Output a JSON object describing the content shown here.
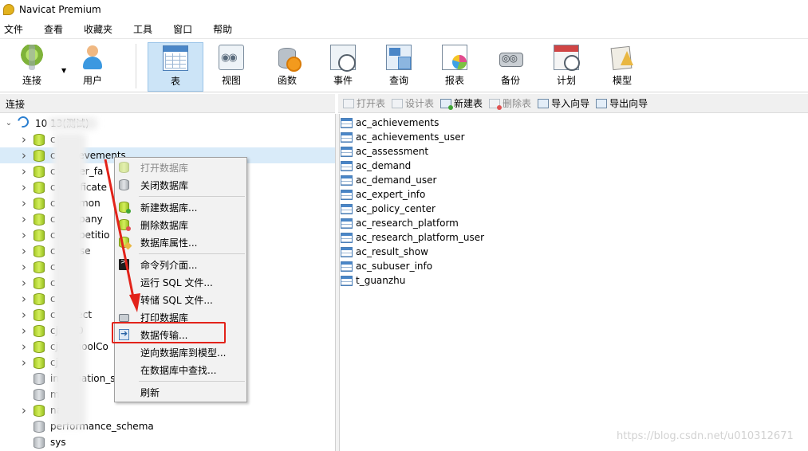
{
  "window": {
    "title": "Navicat Premium"
  },
  "menubar": [
    "文件",
    "查看",
    "收藏夹",
    "工具",
    "窗口",
    "帮助"
  ],
  "toolbar": {
    "buttons": [
      {
        "label": "连接",
        "icon": "connection-icon"
      },
      {
        "label": "用户",
        "icon": "user-icon"
      },
      {
        "label": "表",
        "icon": "table-icon",
        "active": true
      },
      {
        "label": "视图",
        "icon": "view-icon"
      },
      {
        "label": "函数",
        "icon": "function-icon"
      },
      {
        "label": "事件",
        "icon": "event-icon"
      },
      {
        "label": "查询",
        "icon": "query-icon"
      },
      {
        "label": "报表",
        "icon": "report-icon"
      },
      {
        "label": "备份",
        "icon": "backup-icon"
      },
      {
        "label": "计划",
        "icon": "schedule-icon"
      },
      {
        "label": "模型",
        "icon": "model-icon"
      }
    ]
  },
  "connections_panel": {
    "header": "连接",
    "connection_label": "10           13(测试)",
    "tree_items": [
      {
        "label": "c",
        "icon": "database-open-icon",
        "expandable": true
      },
      {
        "label": "c   achievements",
        "icon": "database-open-icon",
        "expandable": true,
        "selected": true
      },
      {
        "label": "c   career_fa",
        "icon": "database-open-icon",
        "expandable": true
      },
      {
        "label": "c   certificate",
        "icon": "database-open-icon",
        "expandable": true
      },
      {
        "label": "c   common",
        "icon": "database-open-icon",
        "expandable": true
      },
      {
        "label": "c   company",
        "icon": "database-open-icon",
        "expandable": true
      },
      {
        "label": "c   competitio",
        "icon": "database-open-icon",
        "expandable": true
      },
      {
        "label": "c   course",
        "icon": "database-open-icon",
        "expandable": true
      },
      {
        "label": "c       xy",
        "icon": "database-open-icon",
        "expandable": true
      },
      {
        "label": "c",
        "icon": "database-open-icon",
        "expandable": true
      },
      {
        "label": "c       p",
        "icon": "database-open-icon",
        "expandable": true
      },
      {
        "label": "c   project",
        "icon": "database-open-icon",
        "expandable": true
      },
      {
        "label": "cjr      100",
        "icon": "database-open-icon",
        "expandable": true
      },
      {
        "label": "cjr  schoolCo",
        "icon": "database-open-icon",
        "expandable": true
      },
      {
        "label": "cj    use",
        "icon": "database-open-icon",
        "expandable": true
      },
      {
        "label": "information_s",
        "icon": "database-closed-icon",
        "expandable": false
      },
      {
        "label": "mysql",
        "icon": "database-closed-icon",
        "expandable": false
      },
      {
        "label": "nacos",
        "icon": "database-open-icon",
        "expandable": true
      },
      {
        "label": "performance_schema",
        "icon": "database-closed-icon",
        "expandable": false
      },
      {
        "label": "sys",
        "icon": "database-closed-icon",
        "expandable": false
      }
    ]
  },
  "object_toolbar": [
    {
      "label": "打开表",
      "disabled": true
    },
    {
      "label": "设计表",
      "disabled": true
    },
    {
      "label": "新建表",
      "disabled": false
    },
    {
      "label": "删除表",
      "disabled": true
    },
    {
      "label": "导入向导",
      "disabled": false
    },
    {
      "label": "导出向导",
      "disabled": false
    }
  ],
  "tables": [
    "ac_achievements",
    "ac_achievements_user",
    "ac_assessment",
    "ac_demand",
    "ac_demand_user",
    "ac_expert_info",
    "ac_policy_center",
    "ac_research_platform",
    "ac_research_platform_user",
    "ac_result_show",
    "ac_subuser_info",
    "t_guanzhu"
  ],
  "context_menu": {
    "items": [
      {
        "label": "打开数据库",
        "disabled": true
      },
      {
        "label": "关闭数据库"
      },
      {
        "label": "新建数据库..."
      },
      {
        "label": "删除数据库"
      },
      {
        "label": "数据库属性..."
      },
      {
        "label": "命令列介面..."
      },
      {
        "label": "运行 SQL 文件..."
      },
      {
        "label": "转储 SQL 文件..."
      },
      {
        "label": "打印数据库"
      },
      {
        "label": "数据传输...",
        "highlighted": true
      },
      {
        "label": "逆向数据库到模型..."
      },
      {
        "label": "在数据库中查找..."
      },
      {
        "label": "刷新"
      }
    ]
  },
  "annotation": {
    "arrow_color": "#e2231a",
    "box_color": "#e2231a"
  },
  "watermark": "https://blog.csdn.net/u010312671"
}
